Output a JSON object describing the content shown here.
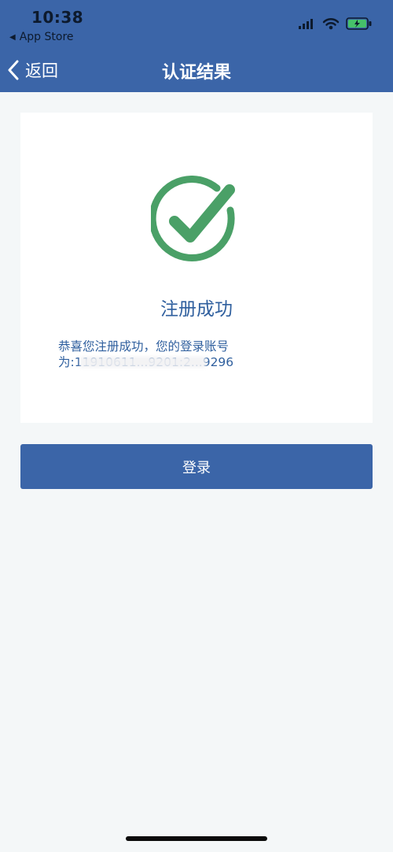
{
  "status_bar": {
    "time": "10:38",
    "back_app_label": "App Store"
  },
  "nav": {
    "back_label": "返回",
    "title": "认证结果"
  },
  "result": {
    "title": "注册成功",
    "message_line1": "恭喜您注册成功，您的登录账号",
    "message_line2": "为:11910611...9201:2...9296"
  },
  "actions": {
    "login_label": "登录"
  },
  "colors": {
    "primary": "#3b65a8",
    "success_green": "#4aa067",
    "text_blue": "#2f5f9e",
    "background": "#f4f7f8"
  },
  "icons": {
    "signal": "signal-icon",
    "wifi": "wifi-icon",
    "battery": "battery-icon",
    "back": "chevron-left-icon",
    "success": "check-circle-icon"
  }
}
